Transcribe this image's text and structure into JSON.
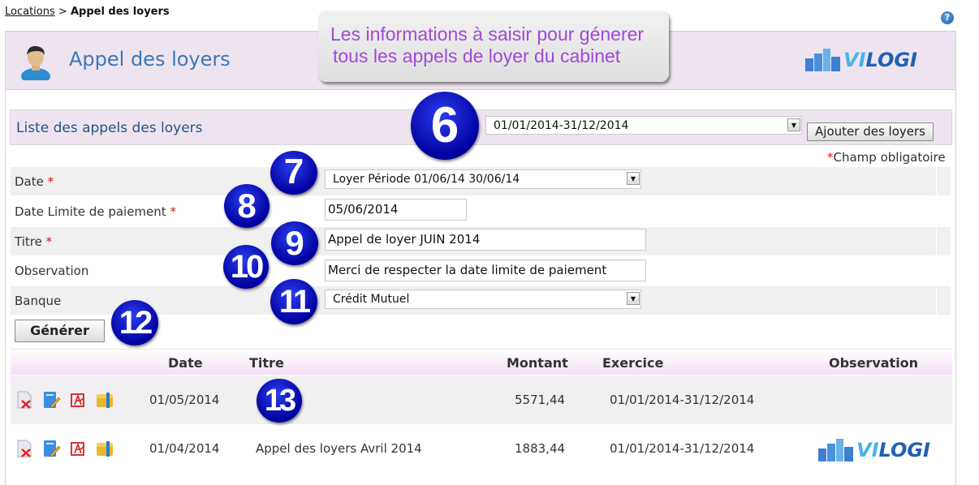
{
  "breadcrumb": {
    "parent": "Locations",
    "separator": ">",
    "current": "Appel des loyers"
  },
  "header": {
    "title": "Appel des loyers",
    "logo": {
      "part1": "VI",
      "part2": "LOGI"
    }
  },
  "callout": {
    "line1": "Les informations à saisir pour génerer",
    "line2": "tous les appels de loyer du cabinet"
  },
  "list": {
    "title": "Liste des appels des loyers",
    "exercise_select": "01/01/2014-31/12/2014",
    "add_button": "Ajouter des loyers",
    "required_note": "Champ obligatoire",
    "required_star": "*"
  },
  "form": {
    "date": {
      "label": "Date",
      "value": "Loyer Période 01/06/14 30/06/14"
    },
    "deadline": {
      "label": "Date Limite de paiement",
      "value": "05/06/2014"
    },
    "title": {
      "label": "Titre",
      "value": "Appel de loyer JUIN 2014"
    },
    "observation": {
      "label": "Observation",
      "value": "Merci de respecter la date limite de paiement"
    },
    "bank": {
      "label": "Banque",
      "value": "Crédit Mutuel"
    },
    "generate_button": "Générer"
  },
  "badges": [
    "6",
    "7",
    "8",
    "9",
    "10",
    "11",
    "12",
    "13"
  ],
  "table": {
    "columns": [
      "Date",
      "Titre",
      "Montant",
      "Exercice",
      "Observation"
    ],
    "rows": [
      {
        "date": "01/05/2014",
        "title": "",
        "amount": "5571,44",
        "exercise": "01/01/2014-31/12/2014",
        "observation": ""
      },
      {
        "date": "01/04/2014",
        "title": "Appel des loyers Avril 2014",
        "amount": "1883,44",
        "exercise": "01/01/2014-31/12/2014",
        "observation": ""
      }
    ],
    "row_actions": [
      "delete-pdf-icon",
      "edit-icon",
      "pdf-icon",
      "zip-icon"
    ]
  },
  "help": {
    "glyph": "?"
  }
}
